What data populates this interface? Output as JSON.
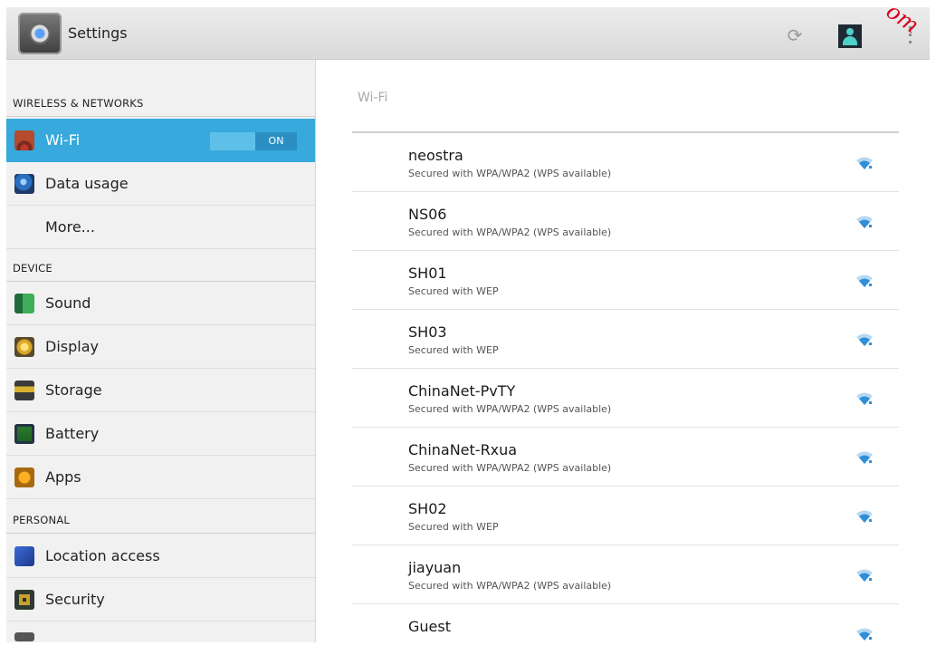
{
  "app": {
    "title": "Settings",
    "watermark": "om"
  },
  "sidebar": {
    "sections": [
      {
        "header": "WIRELESS & NETWORKS"
      },
      {
        "header": "DEVICE"
      },
      {
        "header": "PERSONAL"
      }
    ],
    "items": [
      {
        "label": "Wi-Fi",
        "icon": "wifi-settings-icon",
        "toggle": "ON"
      },
      {
        "label": "Data usage",
        "icon": "data-usage-icon"
      },
      {
        "label": "More..."
      },
      {
        "label": "Sound",
        "icon": "sound-icon"
      },
      {
        "label": "Display",
        "icon": "display-icon"
      },
      {
        "label": "Storage",
        "icon": "storage-icon"
      },
      {
        "label": "Battery",
        "icon": "battery-icon"
      },
      {
        "label": "Apps",
        "icon": "apps-icon"
      },
      {
        "label": "Location access",
        "icon": "location-icon"
      },
      {
        "label": "Security",
        "icon": "security-icon"
      }
    ]
  },
  "main": {
    "title": "Wi-Fi",
    "networks": [
      {
        "ssid": "neostra",
        "security": "Secured with WPA/WPA2 (WPS available)"
      },
      {
        "ssid": "NS06",
        "security": "Secured with WPA/WPA2 (WPS available)"
      },
      {
        "ssid": "SH01",
        "security": "Secured with WEP"
      },
      {
        "ssid": "SH03",
        "security": "Secured with WEP"
      },
      {
        "ssid": "ChinaNet-PvTY",
        "security": "Secured with WPA/WPA2 (WPS available)"
      },
      {
        "ssid": "ChinaNet-Rxua",
        "security": "Secured with WPA/WPA2 (WPS available)"
      },
      {
        "ssid": "SH02",
        "security": "Secured with WEP"
      },
      {
        "ssid": "jiayuan",
        "security": "Secured with WPA/WPA2 (WPS available)"
      },
      {
        "ssid": "Guest",
        "security": ""
      }
    ]
  },
  "colors": {
    "accent": "#37a9dc",
    "signal": "#2f8fd8"
  }
}
